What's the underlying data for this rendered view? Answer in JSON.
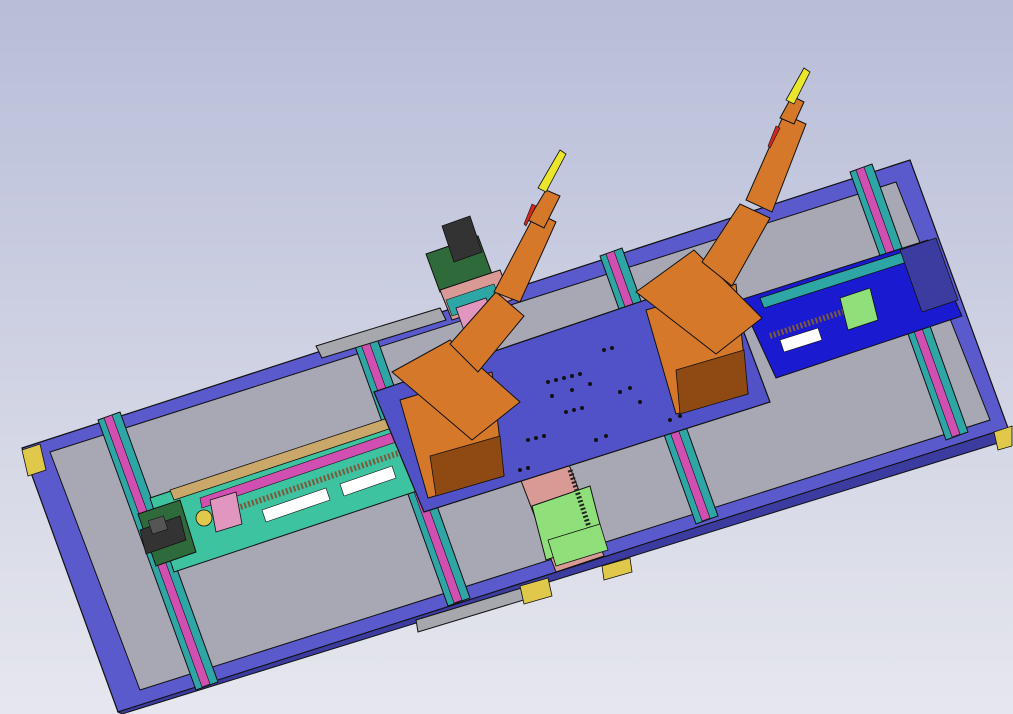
{
  "scene": {
    "description_visible_text": "",
    "background": {
      "top": "#B8BDD8",
      "bottom": "#E6E7EE"
    },
    "colors": {
      "frame": "#5A5ACD",
      "frame_dark": "#3C3CA0",
      "frame_inner": "#A8A8B4",
      "rail": "#2FA6A6",
      "rail_accent": "#D04FB0",
      "platform": "#5252C8",
      "track_left": "#3DC3A0",
      "track_left_inner": "#C9A86A",
      "track_right": "#1A1AD0",
      "ball_screw": "#7C5A3C",
      "robot": "#D6782A",
      "robot_dark": "#8E4A12",
      "torch": "#E9E62B",
      "tip": "#D0281F",
      "motor_green": "#2E6A3A",
      "motor_pink": "#E096BE",
      "pale_green": "#8FE07A",
      "salmon": "#D99A96",
      "gray_plate": "#A7A7AE",
      "bracket_yellow": "#E0C84A",
      "outline": "#111111"
    },
    "parts": [
      "frame",
      "cross-rails",
      "platform",
      "left-linear-track",
      "right-linear-track",
      "center-carriage",
      "left-robot-arm",
      "right-robot-arm",
      "welding-torch-left",
      "welding-torch-right",
      "servo-motor-left",
      "servo-motor-top"
    ]
  }
}
